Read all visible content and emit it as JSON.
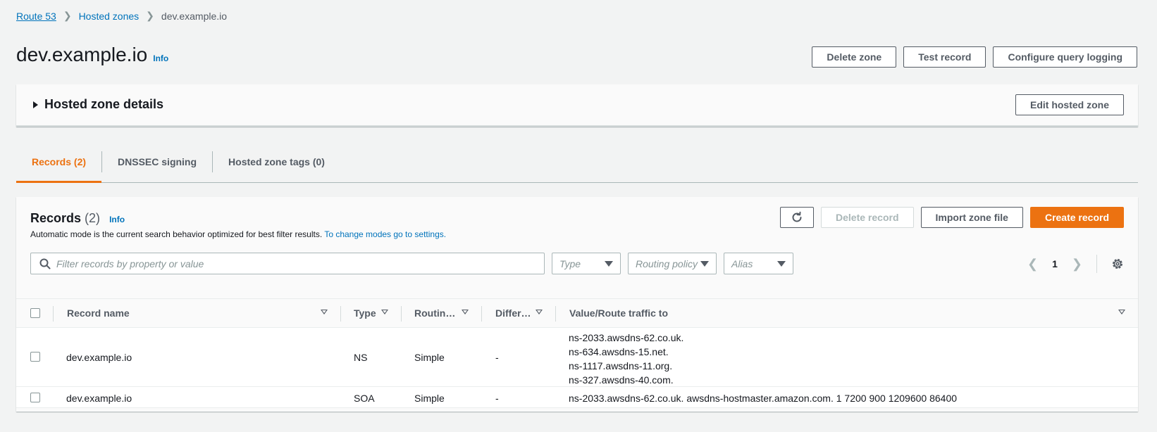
{
  "breadcrumb": {
    "root": "Route 53",
    "hosted_zones": "Hosted zones",
    "current": "dev.example.io"
  },
  "header": {
    "title": "dev.example.io",
    "info": "Info",
    "actions": {
      "delete_zone": "Delete zone",
      "test_record": "Test record",
      "configure_query_logging": "Configure query logging"
    }
  },
  "details": {
    "title": "Hosted zone details",
    "edit_button": "Edit hosted zone"
  },
  "tabs": [
    {
      "label": "Records (2)",
      "active": true
    },
    {
      "label": "DNSSEC signing",
      "active": false
    },
    {
      "label": "Hosted zone tags (0)",
      "active": false
    }
  ],
  "records": {
    "title": "Records",
    "count": "(2)",
    "info": "Info",
    "description": "Automatic mode is the current search behavior optimized for best filter results.",
    "settings_link": "To change modes go to settings.",
    "actions": {
      "delete_record": "Delete record",
      "import_zone_file": "Import zone file",
      "create_record": "Create record"
    },
    "search_placeholder": "Filter records by property or value",
    "filters": {
      "type": "Type",
      "routing_policy": "Routing policy",
      "alias": "Alias"
    },
    "page": "1",
    "columns": {
      "record_name": "Record name",
      "type": "Type",
      "routing": "Routin…",
      "differ": "Differ…",
      "value": "Value/Route traffic to"
    },
    "rows": [
      {
        "name": "dev.example.io",
        "type": "NS",
        "routing": "Simple",
        "differ": "-",
        "values": [
          "ns-2033.awsdns-62.co.uk.",
          "ns-634.awsdns-15.net.",
          "ns-1117.awsdns-11.org.",
          "ns-327.awsdns-40.com."
        ]
      },
      {
        "name": "dev.example.io",
        "type": "SOA",
        "routing": "Simple",
        "differ": "-",
        "values": [
          "ns-2033.awsdns-62.co.uk. awsdns-hostmaster.amazon.com. 1 7200 900 1209600 86400"
        ]
      }
    ]
  },
  "colors": {
    "accent": "#ec7211",
    "link": "#0073bb"
  }
}
